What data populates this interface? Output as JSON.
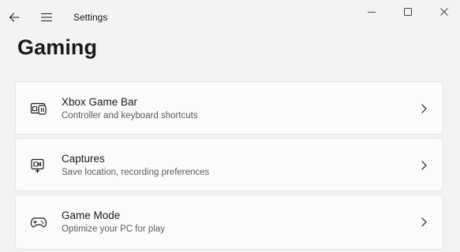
{
  "window": {
    "app_title": "Settings",
    "controls": {
      "back": "back-arrow-icon",
      "menu": "hamburger-menu-icon",
      "minimize": "minimize-icon",
      "maximize": "maximize-icon",
      "close": "close-icon"
    }
  },
  "page": {
    "title": "Gaming"
  },
  "settings_items": [
    {
      "title": "Xbox Game Bar",
      "subtitle": "Controller and keyboard shortcuts",
      "icon": "game-bar-icon"
    },
    {
      "title": "Captures",
      "subtitle": "Save location, recording preferences",
      "icon": "captures-icon"
    },
    {
      "title": "Game Mode",
      "subtitle": "Optimize your PC for play",
      "icon": "game-controller-icon"
    }
  ],
  "colors": {
    "background": "#f3f3f3",
    "card": "#fbfbfb",
    "card_border": "#e5e5e5",
    "text_primary": "#1a1a1a",
    "text_secondary": "#5c5c5c"
  }
}
